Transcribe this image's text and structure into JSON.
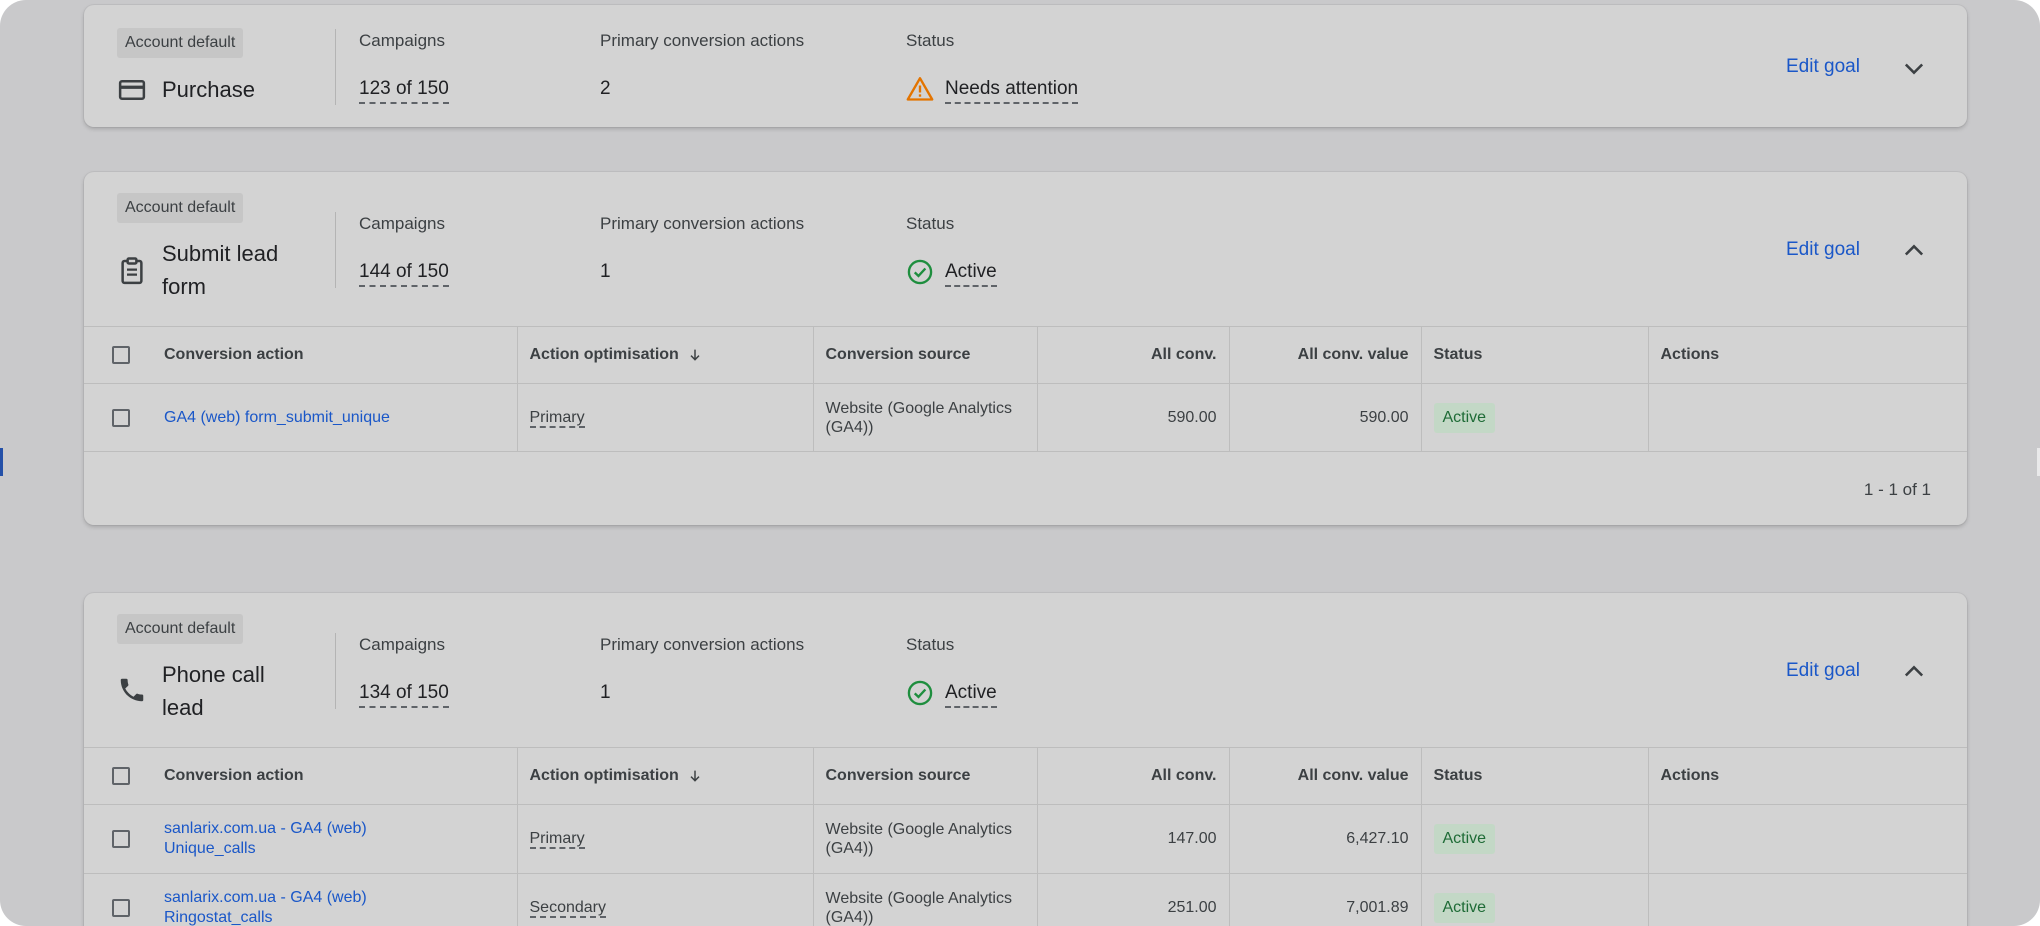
{
  "labels": {
    "badge": "Account default",
    "campaigns": "Campaigns",
    "primary_actions": "Primary conversion actions",
    "status": "Status",
    "edit_goal": "Edit goal"
  },
  "table_headers": {
    "conversion_action": "Conversion action",
    "action_optimisation": "Action optimisation",
    "conversion_source": "Conversion source",
    "all_conv": "All conv.",
    "all_conv_value": "All conv. value",
    "status": "Status",
    "actions": "Actions"
  },
  "goals": [
    {
      "name": "Purchase",
      "icon": "credit-card-icon",
      "campaigns": "123 of 150",
      "primary_actions": "2",
      "status": "Needs attention",
      "status_icon": "warning-icon",
      "expanded": false
    },
    {
      "name_line1": "Submit lead",
      "name_line2": "form",
      "icon": "clipboard-icon",
      "campaigns": "144 of 150",
      "primary_actions": "1",
      "status": "Active",
      "status_icon": "check-circle-icon",
      "expanded": true,
      "rows": [
        {
          "action": "GA4 (web) form_submit_unique",
          "optimisation": "Primary",
          "source_line1": "Website (Google Analytics",
          "source_line2": "(GA4))",
          "all_conv": "590.00",
          "all_conv_value": "590.00",
          "status": "Active"
        }
      ],
      "pager": "1 - 1 of 1"
    },
    {
      "name_line1": "Phone call",
      "name_line2": "lead",
      "icon": "phone-icon",
      "campaigns": "134 of 150",
      "primary_actions": "1",
      "status": "Active",
      "status_icon": "check-circle-icon",
      "expanded": true,
      "rows": [
        {
          "action_line1": "sanlarix.com.ua - GA4 (web)",
          "action_line2": "Unique_calls",
          "optimisation": "Primary",
          "source_line1": "Website (Google Analytics",
          "source_line2": "(GA4))",
          "all_conv": "147.00",
          "all_conv_value": "6,427.10",
          "status": "Active"
        },
        {
          "action_line1": "sanlarix.com.ua - GA4 (web)",
          "action_line2": "Ringostat_calls",
          "optimisation": "Secondary",
          "source_line1": "Website (Google Analytics",
          "source_line2": "(GA4))",
          "all_conv": "251.00",
          "all_conv_value": "7,001.89",
          "status": "Active"
        }
      ]
    }
  ],
  "colors": {
    "link": "#1a57c8",
    "warning": "#e37400",
    "success": "#1e8e3e",
    "active_chip_bg": "#c3d8c6"
  }
}
